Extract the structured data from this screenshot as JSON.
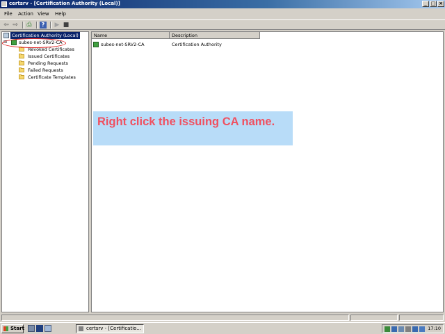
{
  "window": {
    "title": "certsrv - [Certification Authority (Local)]",
    "buttons": {
      "minimize": "_",
      "maximize": "□",
      "close": "×"
    }
  },
  "menu": {
    "items": [
      "File",
      "Action",
      "View",
      "Help"
    ]
  },
  "tree": {
    "root": "Certification Authority (Local)",
    "ca_node": "subes-net-SRV2-CA",
    "folders": [
      "Revoked Certificates",
      "Issued Certificates",
      "Pending Requests",
      "Failed Requests",
      "Certificate Templates"
    ]
  },
  "list": {
    "columns": [
      "Name",
      "Description"
    ],
    "rows": [
      {
        "name": "subes-net-SRV2-CA",
        "description": "Certification Authority"
      }
    ]
  },
  "callout": {
    "text": "Right click the issuing CA name."
  },
  "taskbar": {
    "start_label": "Start",
    "task_label": "certsrv - [Certificatio...",
    "clock": "17:10"
  },
  "colors": {
    "title_bar": "#0a246a",
    "selection": "#0a246a",
    "callout_bg": "#b8dcf8",
    "callout_text": "#f05060",
    "annotation_circle": "#e02020"
  }
}
